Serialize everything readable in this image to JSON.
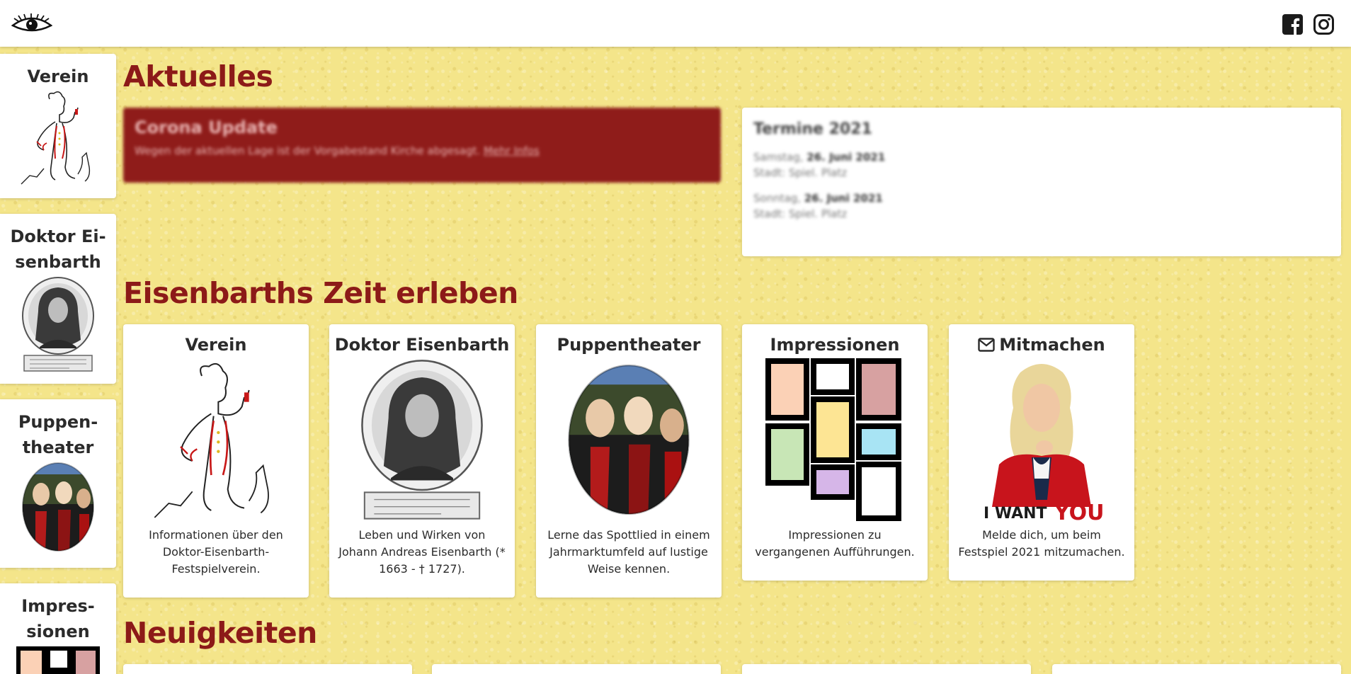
{
  "header": {
    "logo_icon": "eye-logo-icon",
    "social": [
      "facebook-icon",
      "instagram-icon"
    ]
  },
  "sidebar": {
    "items": [
      {
        "label": "Verein",
        "icon": "verein-drawing-icon"
      },
      {
        "label": "Doktor Ei-\nsenbarth",
        "icon": "portrait-icon"
      },
      {
        "label": "Puppen-\ntheater",
        "icon": "puppets-icon"
      },
      {
        "label": "Impres-\nsionen",
        "icon": "gallery-icon"
      }
    ]
  },
  "sections": {
    "aktuelles": "Aktuelles",
    "zeit": "Eisenbarths Zeit erleben",
    "neuigkeiten": "Neuigkeiten"
  },
  "alert": {
    "title": "Corona Update",
    "text": "Wegen der aktuellen Lage ist der Vorgabestand Kirche abgesagt.",
    "link": "Mehr Infos"
  },
  "termine": {
    "title": "Termine 2021",
    "events": [
      {
        "day": "Samstag,",
        "date": "26. Juni 2021",
        "place": "Stadt: Spiel. Platz"
      },
      {
        "day": "Sonntag,",
        "date": "26. Juni 2021",
        "place": "Stadt: Spiel. Platz"
      }
    ]
  },
  "cards": [
    {
      "title": "Verein",
      "text": "Informationen über den Doktor-Eisenbarth-Festspielverein.",
      "icon": "verein-drawing-icon"
    },
    {
      "title": "Doktor Eisenbarth",
      "text": "Leben und Wirken von Johann Andreas Eisenbarth (* 1663 - † 1727).",
      "icon": "portrait-icon"
    },
    {
      "title": "Puppentheater",
      "text": "Lerne das Spottlied in einem Jahrmarktumfeld auf lustige Weise kennen.",
      "icon": "puppets-icon"
    },
    {
      "title": "Impressionen",
      "text": "Impressionen zu vergangenen Aufführungen.",
      "icon": "gallery-icon"
    },
    {
      "title": "Mitmachen",
      "text": "Melde dich, um beim Festspiel 2021 mitzumachen.",
      "icon": "i-want-you-icon",
      "badge_text": "I WANT",
      "badge_text2": "YOU"
    }
  ],
  "colors": {
    "accent": "#8c1a18",
    "alert_bg": "#8f1c1a",
    "background": "#f4e58a"
  }
}
